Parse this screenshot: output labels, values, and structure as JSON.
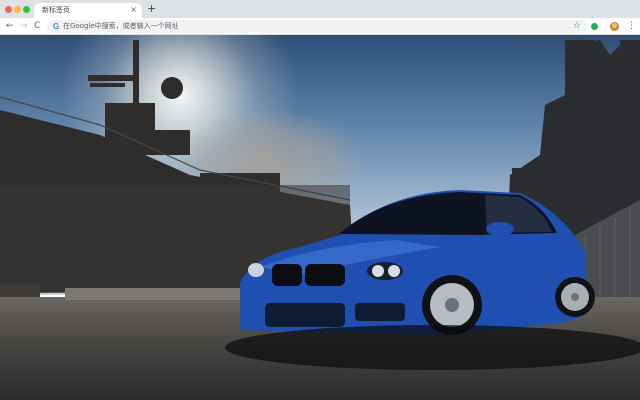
{
  "browser": {
    "tab": {
      "title": "新标签页",
      "close_glyph": "×"
    },
    "new_tab_glyph": "+",
    "toolbar": {
      "back_glyph": "←",
      "forward_glyph": "→",
      "reload_glyph": "C",
      "omnibox_placeholder": "在Google中搜索，或者输入一个网址",
      "search_engine_glyph": "G",
      "bookmark_glyph": "☆",
      "menu_glyph": "⋮"
    }
  },
  "wallpaper": {
    "subject": "blue-sports-car-icon",
    "colors": {
      "car_body": "#1f4fb0",
      "sky": "#5f84ab",
      "ship": "#2f2f33"
    }
  }
}
